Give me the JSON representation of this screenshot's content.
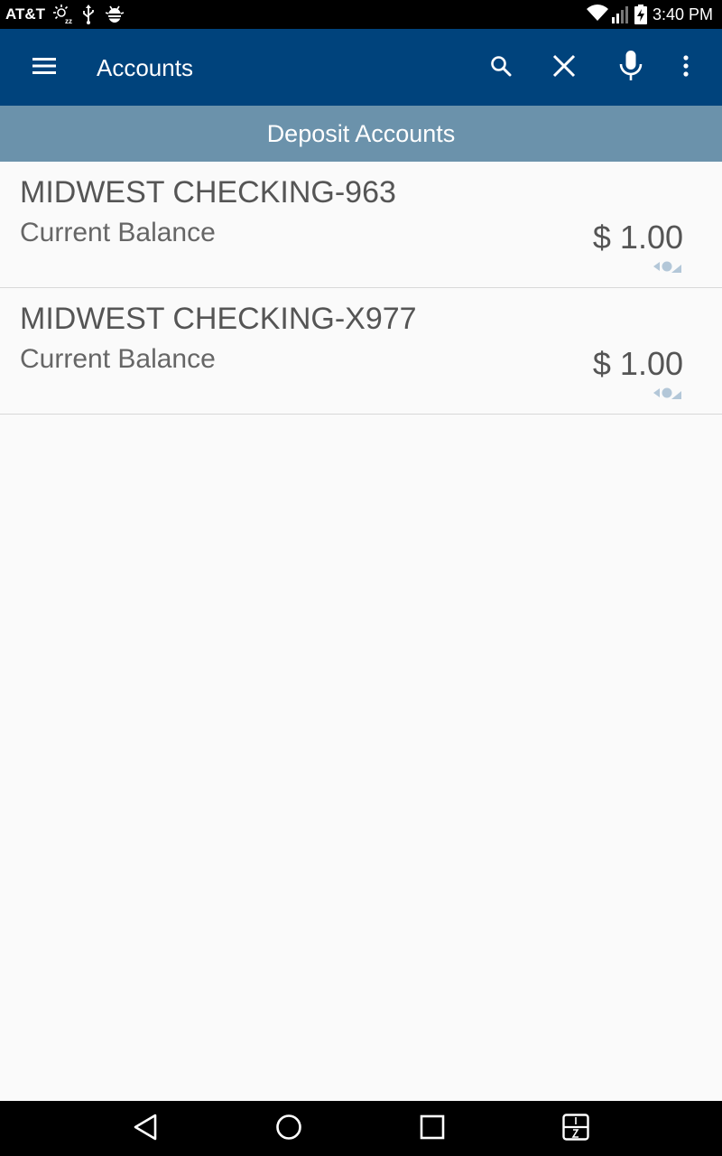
{
  "status_bar": {
    "carrier": "AT&T",
    "time": "3:40 PM",
    "icons": [
      "sleep-mode-icon",
      "usb-icon",
      "android-debug-icon",
      "wifi-icon",
      "signal-icon",
      "battery-charging-icon"
    ]
  },
  "app_bar": {
    "title": "Accounts",
    "color": "#00437c",
    "actions": [
      "menu-icon",
      "search-icon",
      "close-icon",
      "microphone-icon",
      "more-vert-icon"
    ]
  },
  "section": {
    "title": "Deposit Accounts",
    "color": "#6b92ab"
  },
  "accounts": [
    {
      "name": "MIDWEST CHECKING-963",
      "label": "Current Balance",
      "amount": "$ 1.00"
    },
    {
      "name": "MIDWEST CHECKING-X977",
      "label": "Current Balance",
      "amount": "$ 1.00"
    }
  ],
  "nav_bar": {
    "buttons": [
      "back-icon",
      "home-icon",
      "recents-icon",
      "split-screen-icon"
    ]
  }
}
